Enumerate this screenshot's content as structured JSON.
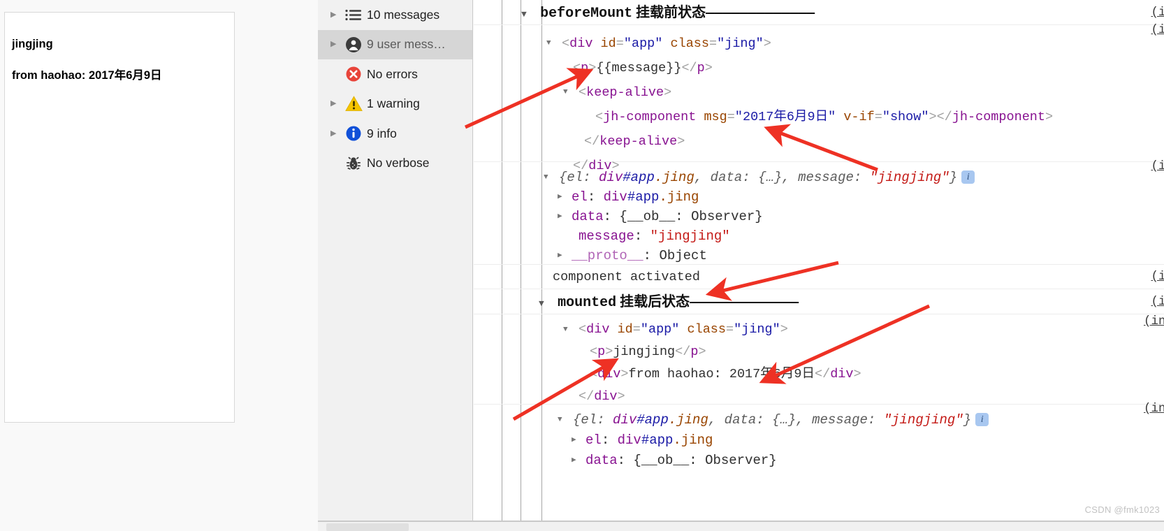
{
  "page_preview": {
    "line1": "jingjing",
    "line2": "from haohao: 2017年6月9日"
  },
  "sidebar": {
    "items": [
      {
        "label": "10 messages",
        "icon": "list-icon",
        "twisty": true,
        "selected": false
      },
      {
        "label": "9 user mess…",
        "icon": "user-icon",
        "twisty": true,
        "selected": true
      },
      {
        "label": "No errors",
        "icon": "error-icon",
        "twisty": false,
        "selected": false
      },
      {
        "label": "1 warning",
        "icon": "warning-icon",
        "twisty": true,
        "selected": false
      },
      {
        "label": "9 info",
        "icon": "info-icon",
        "twisty": true,
        "selected": false
      },
      {
        "label": "No verbose",
        "icon": "bug-icon",
        "twisty": false,
        "selected": false
      }
    ]
  },
  "console": {
    "source_link_short": "(inde",
    "source_link_long": "(index",
    "groups": [
      {
        "header_bold": "beforeMount",
        "header_cn": " 挂载前状态",
        "header_dashes": "—————————————"
      },
      {
        "header_bold": "mounted",
        "header_cn": " 挂载后状态",
        "header_dashes": "—————————————"
      }
    ],
    "dom_1": {
      "div_open": "<div id=\"app\" class=\"jing\">",
      "p_line": "<p>{{message}}</p>",
      "keep_alive_open": "<keep-alive>",
      "jh_component": "<jh-component msg=\"2017年6月9日\" v-if=\"show\"></jh-component>",
      "keep_alive_close": "</keep-alive>",
      "div_close": "</div>"
    },
    "dom_2": {
      "div_open": "<div id=\"app\" class=\"jing\">",
      "p_line": "<p>jingjing</p>",
      "inner_div": "<div>from haohao: 2017年6月9日</div>",
      "div_close": "</div>"
    },
    "vue_object": {
      "summary": "{el: div#app.jing, data: {…}, message: \"jingjing\"}",
      "el_row": "el: div#app.jing",
      "data_row": "data: {__ob__: Observer}",
      "message_row": "message: \"jingjing\"",
      "proto_row": "__proto__: Object"
    },
    "plain_log": "component activated",
    "tokens": {
      "el_key": "el",
      "data_key": "data",
      "message_key": "message",
      "proto_key": "__proto__",
      "observer": "Observer",
      "ob_key": "__ob__",
      "object_type": "Object",
      "message_value": "\"jingjing\"",
      "el_value": "div#app.jing",
      "data_value": "{…}",
      "tag_div": "div",
      "tag_p": "p",
      "tag_keep_alive": "keep-alive",
      "tag_jh_component": "jh-component",
      "attr_id": "id",
      "attr_class": "class",
      "attr_msg": "msg",
      "attr_v_if": "v-if",
      "val_app": "\"app\"",
      "val_jing": "\"jing\"",
      "val_date": "\"2017年6月9日\"",
      "val_show": "\"show\"",
      "text_message_mustache": "{{message}}",
      "text_jingjing": "jingjing",
      "text_from_haohao": "from haohao: 2017年6月9日"
    },
    "info_badge": "i"
  },
  "watermark": "CSDN @fmk1023",
  "colors": {
    "tag": "#881391",
    "attr_name": "#994500",
    "attr_value": "#1a1aa6",
    "string": "#c41a16",
    "key": "#881391",
    "gray": "#5c5c5c",
    "error_red": "#e8443a",
    "warning_yellow": "#f5c400",
    "info_blue": "#1050d8",
    "selection": "#d6d6d6",
    "arrow_red": "#ee3124"
  }
}
